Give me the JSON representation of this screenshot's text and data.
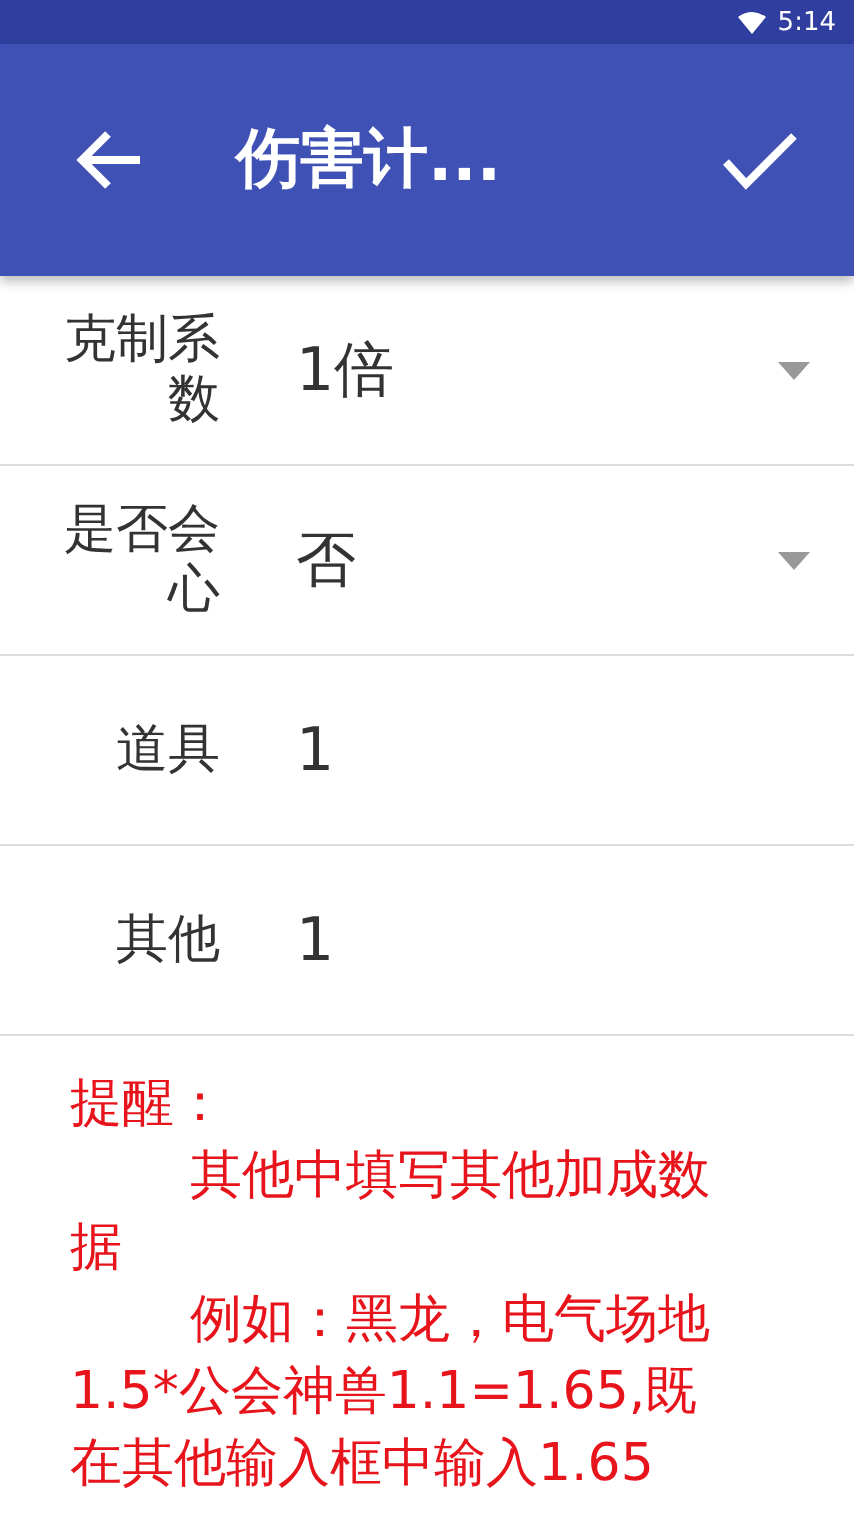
{
  "status_bar": {
    "time": "5:14"
  },
  "app_bar": {
    "title": "伤害计..."
  },
  "rows": [
    {
      "kind": "select",
      "label": "克制系数",
      "value": "1倍"
    },
    {
      "kind": "select",
      "label": "是否会心",
      "value": "否"
    },
    {
      "kind": "input",
      "label": "道具",
      "value": "1"
    },
    {
      "kind": "input",
      "label": "其他",
      "value": "1"
    }
  ],
  "note": {
    "title": "提醒：",
    "paragraphs": [
      "其他中填写其他加成数据",
      "例如：黑龙，电气场地1.5*公会神兽1.1=1.65,既在其他输入框中输入1.65"
    ]
  }
}
